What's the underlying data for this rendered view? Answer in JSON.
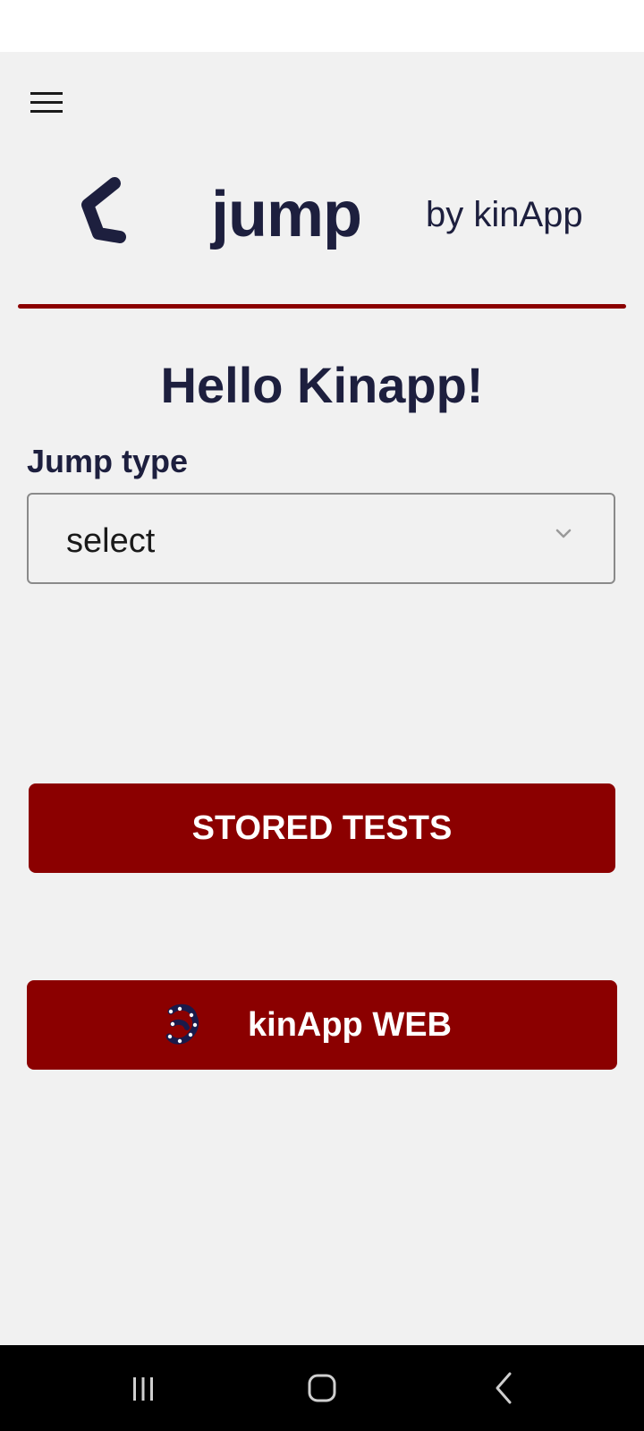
{
  "header": {
    "app_title": "jump",
    "byline": "by kinApp"
  },
  "main": {
    "greeting": "Hello Kinapp!",
    "jump_type_label": "Jump type",
    "jump_type_select_value": "select",
    "stored_tests_label": "STORED TESTS",
    "web_button_label": "kinApp WEB"
  },
  "colors": {
    "brand_dark": "#1d1f3e",
    "accent_red": "#8b0000",
    "background": "#f1f1f1"
  },
  "icons": {
    "menu": "hamburger-menu-icon",
    "logo": "kinapp-leg-logo-icon",
    "dropdown": "chevron-down-icon",
    "web": "kinapp-web-icon",
    "nav_recent": "recent-apps-icon",
    "nav_home": "home-icon",
    "nav_back": "back-icon"
  }
}
